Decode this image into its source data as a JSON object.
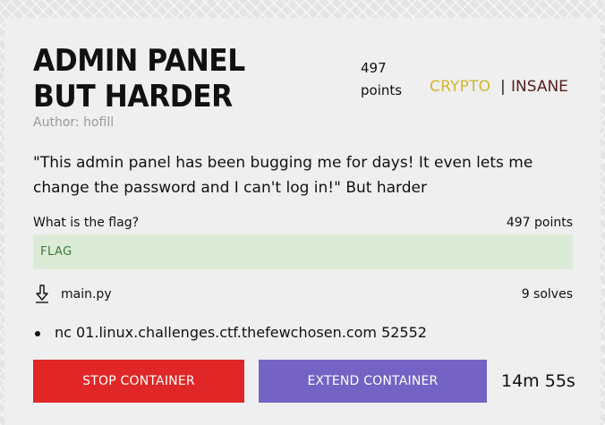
{
  "challenge": {
    "title": "ADMIN PANEL BUT HARDER",
    "points_value": "497",
    "points_unit": "points",
    "category": "CRYPTO",
    "separator": "|",
    "difficulty": "INSANE",
    "author_label": "Author:",
    "author_name": "hofill",
    "description": "\"This admin panel has been bugging me for days! It even lets me change the password and I can't log in!\" But harder"
  },
  "question": {
    "label": "What is the flag?",
    "points": "497 points",
    "flag_placeholder": "FLAG",
    "flag_value": ""
  },
  "file": {
    "icon": "download-icon",
    "name": "main.py"
  },
  "solves": "9 solves",
  "connection": {
    "items": [
      "nc 01.linux.challenges.ctf.thefewchosen.com 52552"
    ]
  },
  "actions": {
    "stop_label": "STOP CONTAINER",
    "extend_label": "EXTEND CONTAINER",
    "timer": "14m 55s"
  },
  "colors": {
    "category": "#d4b52e",
    "difficulty": "#5a1a1a",
    "stop_button": "#e02626",
    "extend_button": "#7462c4",
    "flag_input_bg": "#dcebd5"
  }
}
